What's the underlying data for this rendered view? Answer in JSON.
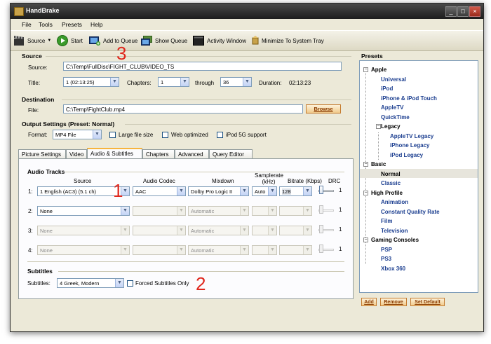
{
  "window": {
    "title": "HandBrake"
  },
  "menu": [
    "File",
    "Tools",
    "Presets",
    "Help"
  ],
  "toolbar": {
    "source": "Source",
    "start": "Start",
    "add_to_queue": "Add to Queue",
    "show_queue": "Show Queue",
    "activity_window": "Activity Window",
    "minimize_tray": "Minimize To System Tray"
  },
  "source": {
    "section": "Source",
    "source_label": "Source:",
    "source_value": "C:\\Temp\\FullDisc\\FIGHT_CLUB\\VIDEO_TS",
    "title_label": "Title:",
    "title_value": "1 (02:13:25)",
    "chapters_label": "Chapters:",
    "chapter_from": "1",
    "through_label": "through",
    "chapter_to": "36",
    "duration_label": "Duration:",
    "duration_value": "02:13:23"
  },
  "destination": {
    "section": "Destination",
    "file_label": "File:",
    "file_value": "C:\\Temp\\FightClub.mp4",
    "browse": "Browse"
  },
  "output": {
    "section": "Output Settings (Preset: Normal)",
    "format_label": "Format:",
    "format_value": "MP4 File",
    "large_file": "Large file size",
    "web_optimized": "Web optimized",
    "ipod": "iPod 5G support"
  },
  "tabs": [
    "Picture Settings",
    "Video",
    "Audio & Subtitles",
    "Chapters",
    "Advanced",
    "Query Editor"
  ],
  "audio": {
    "section": "Audio Tracks",
    "col_source": "Source",
    "col_codec": "Audio Codec",
    "col_mixdown": "Mixdown",
    "col_samplerate": "Samplerate (kHz)",
    "col_bitrate": "Bitrate (Kbps)",
    "col_drc": "DRC",
    "tracks": [
      {
        "num": "1:",
        "source": "1 English (AC3) (5.1 ch)",
        "codec": "AAC",
        "mixdown": "Dolby Pro Logic II",
        "samplerate": "Auto",
        "bitrate": "128",
        "drc": "1"
      },
      {
        "num": "2:",
        "source": "None",
        "codec": "",
        "mixdown": "Automatic",
        "samplerate": "",
        "bitrate": "",
        "drc": "1"
      },
      {
        "num": "3:",
        "source": "None",
        "codec": "",
        "mixdown": "Automatic",
        "samplerate": "",
        "bitrate": "",
        "drc": "1"
      },
      {
        "num": "4:",
        "source": "None",
        "codec": "",
        "mixdown": "Automatic",
        "samplerate": "",
        "bitrate": "",
        "drc": "1"
      }
    ]
  },
  "subtitles": {
    "section": "Subtitles",
    "label": "Subtitles:",
    "value": "4 Greek, Modern",
    "forced": "Forced Subtitles Only"
  },
  "annotations": [
    "3",
    "1",
    "2"
  ],
  "presets": {
    "section": "Presets",
    "apple": "Apple",
    "universal": "Universal",
    "ipod": "iPod",
    "iphone": "iPhone & iPod Touch",
    "appletv": "AppleTV",
    "quicktime": "QuickTime",
    "legacy": "Legacy",
    "appletv_legacy": "AppleTV Legacy",
    "iphone_legacy": "iPhone Legacy",
    "ipod_legacy": "iPod Legacy",
    "basic": "Basic",
    "normal": "Normal",
    "classic": "Classic",
    "high_profile": "High Profile",
    "animation": "Animation",
    "constant_quality": "Constant Quality Rate",
    "film": "Film",
    "television": "Television",
    "gaming": "Gaming Consoles",
    "psp": "PSP",
    "ps3": "PS3",
    "xbox": "Xbox 360",
    "add": "Add",
    "remove": "Remove",
    "set_default": "Set Default"
  }
}
